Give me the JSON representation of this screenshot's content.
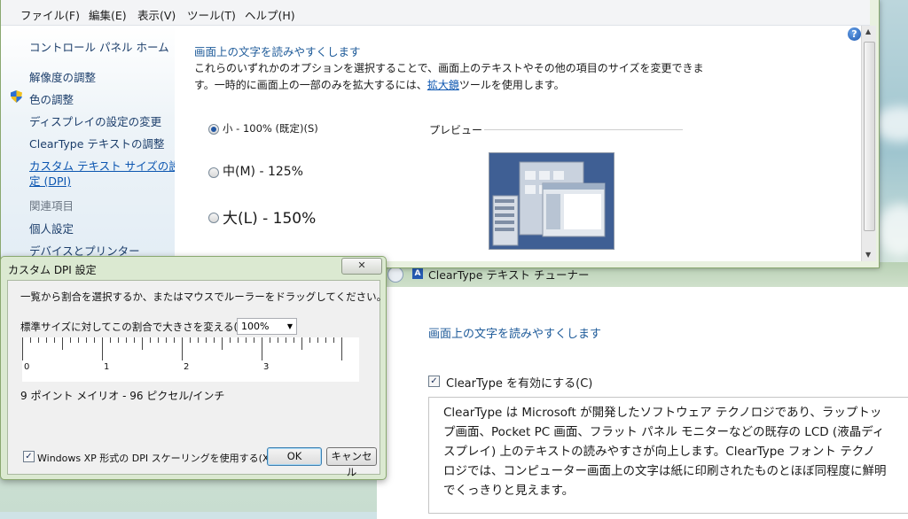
{
  "menu": [
    "ファイル(F)",
    "編集(E)",
    "表示(V)",
    "ツール(T)",
    "ヘルプ(H)"
  ],
  "nav": {
    "home": "コントロール パネル ホーム",
    "items": [
      "解像度の調整",
      "色の調整",
      "ディスプレイの設定の変更",
      "ClearType テキストの調整"
    ],
    "custom_line1": "カスタム テキスト サイズの設",
    "custom_line2": "定 (DPI)",
    "related_heading": "関連項目",
    "related": [
      "個人設定",
      "デバイスとプリンター"
    ]
  },
  "content": {
    "heading": "画面上の文字を読みやすくします",
    "para_line1": "これらのいずれかのオプションを選択することで、画面上のテキストやその他の項目のサイズを変更できま",
    "para_line2_pre": "す。一時的に画面上の一部のみを拡大するには、",
    "para_link": "拡大鏡",
    "para_line2_post": "ツールを使用します。",
    "options": [
      {
        "label": "小 - 100% (既定)(S)",
        "selected": true
      },
      {
        "label": "中(M) - 125%",
        "selected": false
      },
      {
        "label": "大(L) - 150%",
        "selected": false
      }
    ],
    "preview_label": "プレビュー"
  },
  "cleartype": {
    "title": "ClearType テキスト チューナー",
    "heading": "画面上の文字を読みやすくします",
    "checkbox_label": "ClearType を有効にする(C)",
    "checkbox_checked": true,
    "description": "ClearType は Microsoft が開発したソフトウェア テクノロジであり、ラップトップ画面、Pocket PC 画面、フラット パネル モニターなどの既存の LCD (液晶ディスプレイ) 上のテキストの読みやすさが向上します。ClearType フォント テクノロジでは、コンピューター画面上の文字は紙に印刷されたものとほぼ同程度に鮮明でくっきりと見えます。"
  },
  "dialog": {
    "title": "カスタム DPI 設定",
    "close": "✕",
    "instruction": "一覧から割合を選択するか、またはマウスでルーラーをドラッグしてください。",
    "scale_label": "標準サイズに対してこの割合で大きさを変える(S):",
    "scale_value": "100%",
    "ruler_labels": [
      "0",
      "1",
      "2",
      "3"
    ],
    "sample_text": "9 ポイント メイリオ - 96 ピクセル/インチ",
    "xp_checkbox": "Windows XP 形式の DPI スケーリングを使用する(X)",
    "xp_checked": true,
    "ok": "OK",
    "cancel": "キャンセル"
  }
}
